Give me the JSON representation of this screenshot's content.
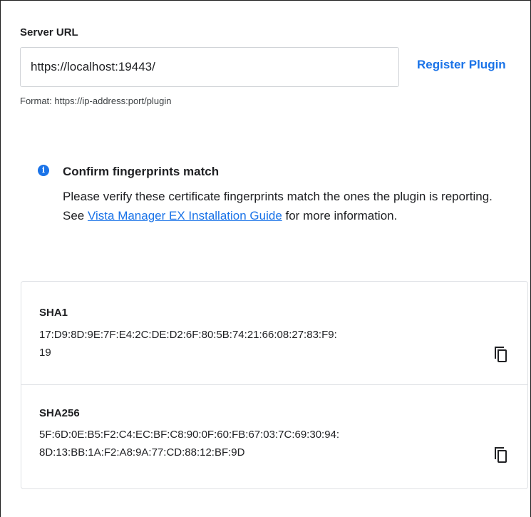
{
  "server": {
    "label": "Server URL",
    "url_value": "https://localhost:19443/",
    "format_hint": "Format: https://ip-address:port/plugin",
    "register_label": "Register Plugin"
  },
  "info": {
    "icon": "info-icon",
    "title": "Confirm fingerprints match",
    "text_before": "Please verify these certificate fingerprints match the ones the plugin is reporting. See ",
    "link_text": "Vista Manager EX Installation Guide",
    "text_after": " for more information."
  },
  "fingerprints": [
    {
      "name": "SHA1",
      "value_lines": [
        "17:D9:8D:9E:7F:E4:2C:DE:D2:6F:80:5B:74:21:66:08:27:83:F9:",
        "19"
      ],
      "copy_icon": "copy-icon"
    },
    {
      "name": "SHA256",
      "value_lines": [
        "5F:6D:0E:B5:F2:C4:EC:BF:C8:90:0F:60:FB:67:03:7C:69:30:94:",
        "8D:13:BB:1A:F2:A8:9A:77:CD:88:12:BF:9D"
      ],
      "copy_icon": "copy-icon"
    }
  ],
  "colors": {
    "accent": "#1a73e8",
    "text": "#202124",
    "border": "#dfe1e5"
  }
}
